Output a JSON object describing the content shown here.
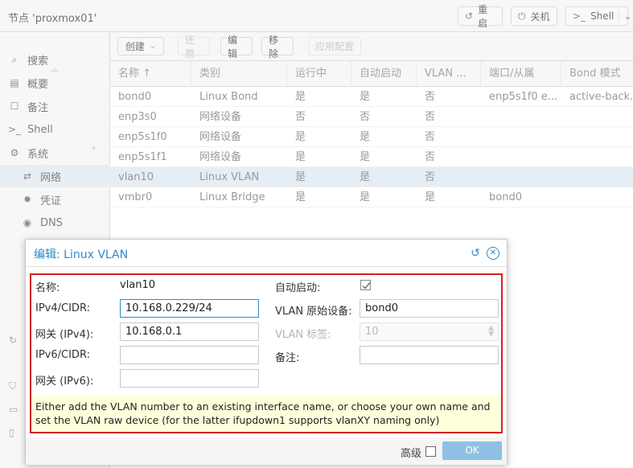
{
  "topbar": {
    "node_title": "节点 'proxmox01'",
    "reboot": "重启",
    "shutdown": "关机",
    "shell": "Shell"
  },
  "sidebar": {
    "items": [
      {
        "label": "搜索",
        "icon": "search-icon"
      },
      {
        "label": "概要",
        "icon": "book-icon"
      },
      {
        "label": "备注",
        "icon": "note-icon"
      },
      {
        "label": "Shell",
        "icon": "terminal-icon"
      },
      {
        "label": "系统",
        "icon": "cogs-icon"
      },
      {
        "label": "网络",
        "icon": "exchange-icon"
      },
      {
        "label": "凭证",
        "icon": "certificate-icon"
      },
      {
        "label": "DNS",
        "icon": "globe-icon"
      }
    ]
  },
  "toolbar": {
    "create": "创建",
    "revert": "还原",
    "edit": "编辑",
    "remove": "移除",
    "apply": "应用配置"
  },
  "table": {
    "columns": [
      "名称 ↑",
      "类别",
      "运行中",
      "自动启动",
      "VLAN ...",
      "端口/从属",
      "Bond 模式"
    ],
    "rows": [
      [
        "bond0",
        "Linux Bond",
        "是",
        "是",
        "否",
        "enp5s1f0 e...",
        "active-back..."
      ],
      [
        "enp3s0",
        "网络设备",
        "否",
        "否",
        "否",
        "",
        ""
      ],
      [
        "enp5s1f0",
        "网络设备",
        "是",
        "是",
        "否",
        "",
        ""
      ],
      [
        "enp5s1f1",
        "网络设备",
        "是",
        "是",
        "否",
        "",
        ""
      ],
      [
        "vlan10",
        "Linux VLAN",
        "是",
        "是",
        "否",
        "",
        ""
      ],
      [
        "vmbr0",
        "Linux Bridge",
        "是",
        "是",
        "是",
        "bond0",
        ""
      ]
    ]
  },
  "dialog": {
    "title": "编辑: Linux VLAN",
    "name_label": "名称:",
    "name_value": "vlan10",
    "ipv4_label": "IPv4/CIDR:",
    "ipv4_value": "10.168.0.229/24",
    "gw4_label": "网关 (IPv4):",
    "gw4_value": "10.168.0.1",
    "ipv6_label": "IPv6/CIDR:",
    "ipv6_value": "",
    "gw6_label": "网关 (IPv6):",
    "gw6_value": "",
    "autostart_label": "自动启动:",
    "autostart_checked": true,
    "raw_label": "VLAN 原始设备:",
    "raw_value": "bond0",
    "tag_label": "VLAN 标签:",
    "tag_value": "10",
    "comment_label": "备注:",
    "comment_value": "",
    "note": "Either add the VLAN number to an existing interface name, or choose your own name and set the VLAN raw device (for the latter ifupdown1 supports vlanXY naming only)",
    "advanced_label": "高级",
    "ok": "OK"
  },
  "colors": {
    "accent": "#3188c5",
    "highlight": "#d32121",
    "note_bg": "#ffffdc",
    "ok_bg": "#8ec1e3"
  }
}
